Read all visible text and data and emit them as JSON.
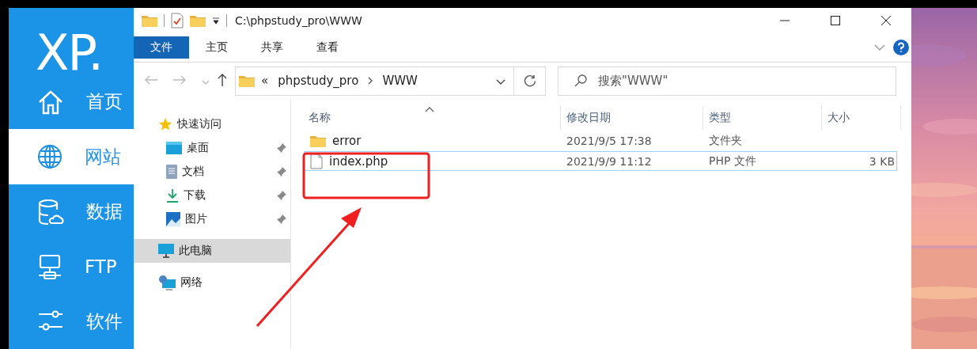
{
  "app_panel": {
    "logo": "XP.",
    "items": [
      {
        "label": "首页",
        "kind": "home",
        "selected": false
      },
      {
        "label": "网站",
        "kind": "globe",
        "selected": true
      },
      {
        "label": "数据",
        "kind": "database",
        "selected": false
      },
      {
        "label": "FTP",
        "kind": "ftp",
        "selected": false
      },
      {
        "label": "软件",
        "kind": "sliders",
        "selected": false
      }
    ]
  },
  "explorer": {
    "title": "C:\\phpstudy_pro\\WWW",
    "ribbon_tabs": [
      {
        "label": "文件",
        "selected": true
      },
      {
        "label": "主页",
        "selected": false
      },
      {
        "label": "共享",
        "selected": false
      },
      {
        "label": "查看",
        "selected": false
      }
    ],
    "address": {
      "parent_marker": "«",
      "path": [
        "phpstudy_pro",
        "WWW"
      ]
    },
    "search": {
      "placeholder": "搜索\"WWW\""
    },
    "navigation": [
      {
        "label": "快速访问",
        "kind": "star",
        "selected": false,
        "children": [
          {
            "label": "桌面",
            "kind": "desktop",
            "pinned": true,
            "selected": false
          },
          {
            "label": "文档",
            "kind": "document",
            "pinned": true,
            "selected": false
          },
          {
            "label": "下载",
            "kind": "download",
            "pinned": true,
            "selected": false
          },
          {
            "label": "图片",
            "kind": "pictures",
            "pinned": true,
            "selected": false
          }
        ]
      },
      {
        "label": "此电脑",
        "kind": "computer",
        "selected": true
      },
      {
        "label": "网络",
        "kind": "network",
        "selected": false
      }
    ],
    "columns": [
      "名称",
      "修改日期",
      "类型",
      "大小"
    ],
    "files": [
      {
        "name": "error",
        "kind": "folder",
        "modified": "2021/9/5 17:38",
        "type": "文件夹",
        "selected": false
      },
      {
        "name": "index.php",
        "kind": "file",
        "modified": "2021/9/9 11:12",
        "type": "PHP 文件",
        "size": "3 KB",
        "selected": true
      }
    ]
  }
}
